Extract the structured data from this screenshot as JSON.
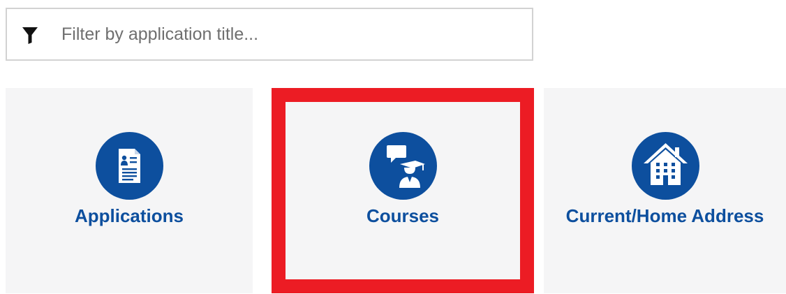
{
  "filter": {
    "placeholder": "Filter by application title...",
    "value": "",
    "icon": "filter-icon"
  },
  "tiles": [
    {
      "label": "Applications",
      "icon": "document-profile-icon",
      "selected": false
    },
    {
      "label": "Courses",
      "icon": "graduate-speech-icon",
      "selected": true
    },
    {
      "label": "Current/Home Address",
      "icon": "house-icon",
      "selected": false
    }
  ],
  "colors": {
    "accent": "#0d4f9e",
    "highlight": "#ec1c24",
    "tile_background": "#f5f5f6"
  }
}
